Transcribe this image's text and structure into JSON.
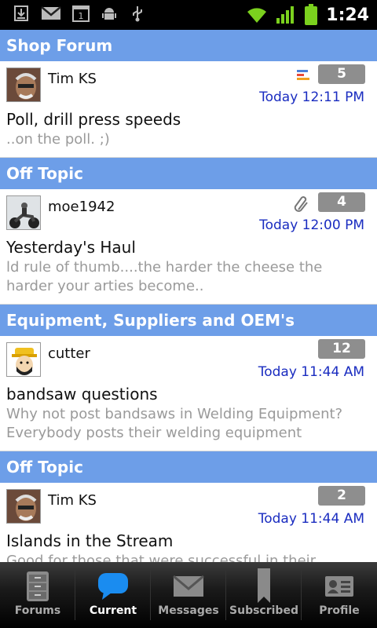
{
  "status_bar": {
    "time": "1:24",
    "icons": [
      "download-icon",
      "gmail-icon",
      "calendar-icon",
      "android-debug-icon",
      "usb-icon",
      "wifi-icon",
      "signal-icon",
      "battery-icon"
    ],
    "calendar_day": "1"
  },
  "feed": [
    {
      "forum": "Shop Forum",
      "author": "Tim KS",
      "count": "5",
      "time": "Today 12:11 PM",
      "title": "Poll, drill press speeds",
      "snippet": "..on the poll.   ;)",
      "badge": "poll-icon"
    },
    {
      "forum": "Off Topic",
      "author": "moe1942",
      "count": "4",
      "time": "Today 12:00 PM",
      "title": "Yesterday's Haul",
      "snippet": "ld rule of thumb....the harder the cheese the harder your arties become..",
      "badge": "paperclip-icon"
    },
    {
      "forum": "Equipment, Suppliers and OEM's",
      "author": "cutter",
      "count": "12",
      "time": "Today 11:44 AM",
      "title": "bandsaw questions",
      "snippet": "Why not post bandsaws in Welding Equipment? Everybody posts their welding equipment",
      "badge": ""
    },
    {
      "forum": "Off Topic",
      "author": "Tim KS",
      "count": "2",
      "time": "Today 11:44 AM",
      "title": "Islands in the Stream",
      "snippet": "Good for those that were successful in their",
      "badge": ""
    }
  ],
  "tabs": [
    {
      "label": "Forums",
      "icon": "forums-cabinet-icon",
      "active": false
    },
    {
      "label": "Current",
      "icon": "chat-bubble-icon",
      "active": true
    },
    {
      "label": "Messages",
      "icon": "envelope-icon",
      "active": false
    },
    {
      "label": "Subscribed",
      "icon": "bookmark-icon",
      "active": false
    },
    {
      "label": "Profile",
      "icon": "profile-card-icon",
      "active": false
    }
  ],
  "colors": {
    "section_header": "#6d9ee8",
    "time_text": "#1a2cc0",
    "count_badge": "#8e8e8e",
    "snippet_text": "#9a9a9a"
  }
}
